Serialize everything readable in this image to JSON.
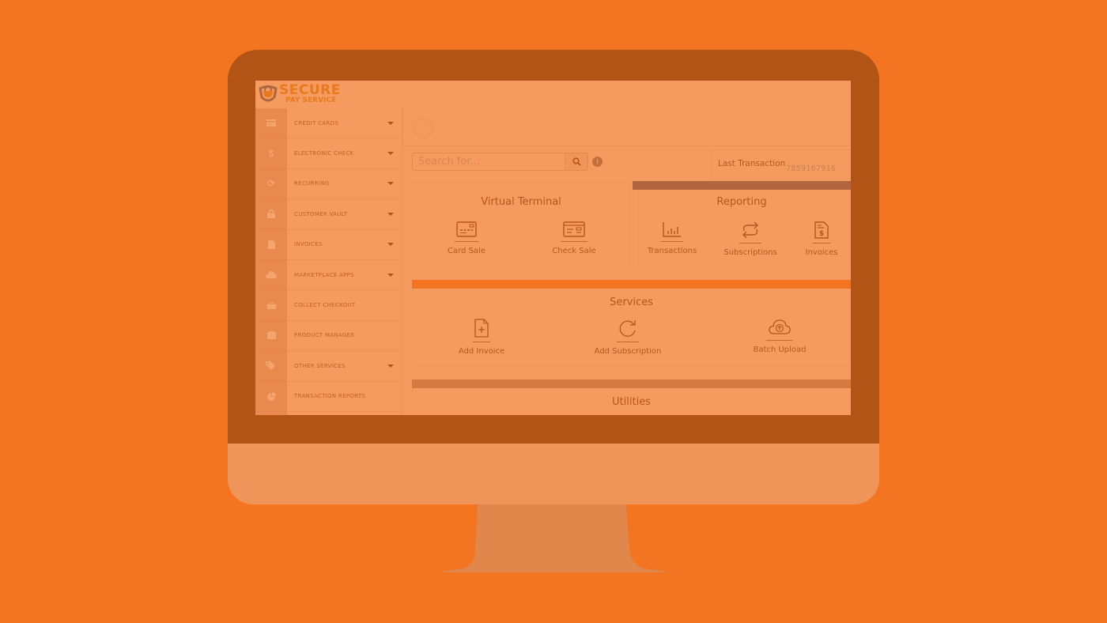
{
  "brand": {
    "name_main": "SECURE",
    "name_sub": "PAY SERVICE"
  },
  "colors": {
    "background": "#f37521",
    "bezel": "#b15415",
    "chin": "#ef955a",
    "stand": "#e1874b",
    "screen_overlay": "#f59b5f",
    "text_accent": "#b5581c"
  },
  "sidebar": {
    "items": [
      {
        "label": "Credit Cards",
        "icon": "credit-card-icon",
        "has_dropdown": true
      },
      {
        "label": "Electronic Check",
        "icon": "dollar-icon",
        "has_dropdown": true
      },
      {
        "label": "Recurring",
        "icon": "refresh-icon",
        "has_dropdown": true
      },
      {
        "label": "Customer Vault",
        "icon": "lock-icon",
        "has_dropdown": true
      },
      {
        "label": "Invoices",
        "icon": "invoice-icon",
        "has_dropdown": true
      },
      {
        "label": "Marketplace Apps",
        "icon": "cloud-icon",
        "has_dropdown": true
      },
      {
        "label": "Collect Checkout",
        "icon": "basket-icon",
        "has_dropdown": false
      },
      {
        "label": "Product Manager",
        "icon": "box-icon",
        "has_dropdown": false
      },
      {
        "label": "Other Services",
        "icon": "tags-icon",
        "has_dropdown": true
      },
      {
        "label": "Transaction Reports",
        "icon": "pie-chart-icon",
        "has_dropdown": false
      }
    ]
  },
  "search": {
    "placeholder": "Search for...",
    "value": ""
  },
  "last_transaction": {
    "label": "Last Transaction",
    "value": "7859167916"
  },
  "virtual_terminal": {
    "title": "Virtual Terminal",
    "tiles": [
      {
        "label": "Card Sale",
        "icon": "card-sale-icon"
      },
      {
        "label": "Check Sale",
        "icon": "check-sale-icon"
      }
    ]
  },
  "reporting": {
    "title": "Reporting",
    "tiles": [
      {
        "label": "Transactions",
        "icon": "bar-chart-icon"
      },
      {
        "label": "Subscriptions",
        "icon": "repeat-icon"
      },
      {
        "label": "Invoices",
        "icon": "invoice-dollar-icon"
      }
    ]
  },
  "services": {
    "title": "Services",
    "tiles": [
      {
        "label": "Add Invoice",
        "icon": "add-file-icon"
      },
      {
        "label": "Add Subscription",
        "icon": "rotate-icon"
      },
      {
        "label": "Batch Upload",
        "icon": "cloud-upload-icon"
      }
    ]
  },
  "utilities": {
    "title": "Utilities"
  }
}
